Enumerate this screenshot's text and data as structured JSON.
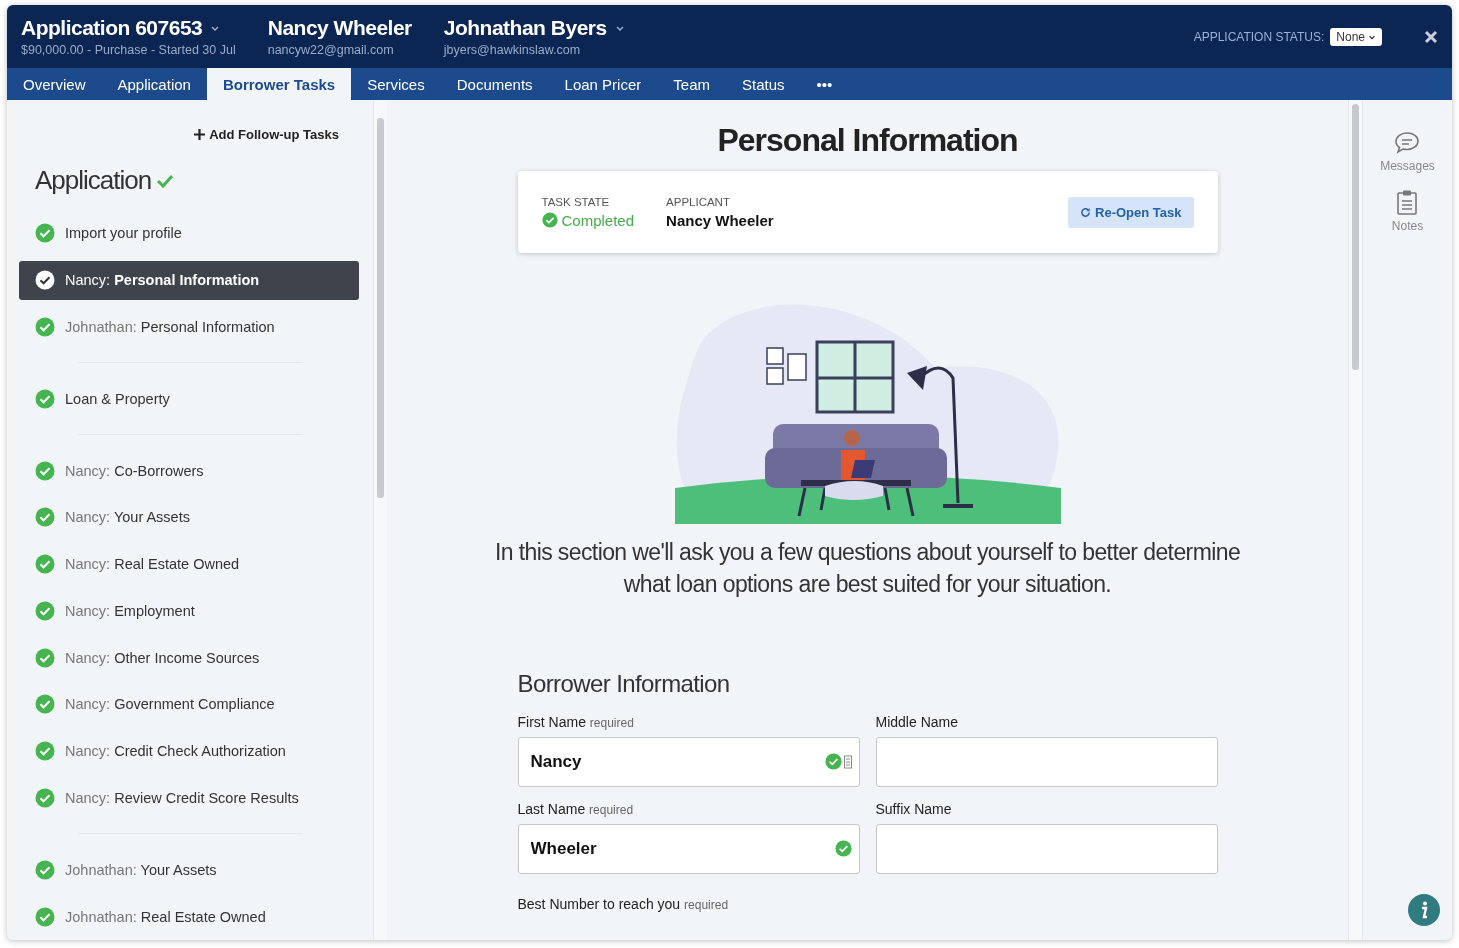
{
  "header": {
    "application": {
      "title": "Application 607653",
      "subtitle": "$90,000.00 - Purchase - Started 30 Jul"
    },
    "borrowers": [
      {
        "name": "Nancy Wheeler",
        "email": "nancyw22@gmail.com",
        "has_menu": false
      },
      {
        "name": "Johnathan Byers",
        "email": "jbyers@hawkinslaw.com",
        "has_menu": true
      }
    ],
    "status_label": "APPLICATION STATUS:",
    "status_value": "None"
  },
  "tabs": [
    {
      "label": "Overview",
      "selected": false
    },
    {
      "label": "Application",
      "selected": false
    },
    {
      "label": "Borrower Tasks",
      "selected": true
    },
    {
      "label": "Services",
      "selected": false
    },
    {
      "label": "Documents",
      "selected": false
    },
    {
      "label": "Loan Pricer",
      "selected": false
    },
    {
      "label": "Team",
      "selected": false
    },
    {
      "label": "Status",
      "selected": false
    }
  ],
  "more_tabs": "•••",
  "sidebar": {
    "add_button": "Add Follow-up Tasks",
    "section_title": "Application",
    "section_complete": true,
    "groups": [
      [
        {
          "title": "Import your profile",
          "completed": true,
          "selected": false
        },
        {
          "prefix": "Nancy:",
          "title": "Personal Information",
          "completed": true,
          "selected": true
        },
        {
          "prefix": "Johnathan:",
          "title": "Personal Information",
          "completed": true,
          "selected": false
        }
      ],
      [
        {
          "title": "Loan & Property",
          "completed": true,
          "selected": false
        }
      ],
      [
        {
          "prefix": "Nancy:",
          "title": "Co-Borrowers",
          "completed": true,
          "selected": false
        },
        {
          "prefix": "Nancy:",
          "title": "Your Assets",
          "completed": true,
          "selected": false
        },
        {
          "prefix": "Nancy:",
          "title": "Real Estate Owned",
          "completed": true,
          "selected": false
        },
        {
          "prefix": "Nancy:",
          "title": "Employment",
          "completed": true,
          "selected": false
        },
        {
          "prefix": "Nancy:",
          "title": "Other Income Sources",
          "completed": true,
          "selected": false
        },
        {
          "prefix": "Nancy:",
          "title": "Government Compliance",
          "completed": true,
          "selected": false
        },
        {
          "prefix": "Nancy:",
          "title": "Credit Check Authorization",
          "completed": true,
          "selected": false
        },
        {
          "prefix": "Nancy:",
          "title": "Review Credit Score Results",
          "completed": true,
          "selected": false
        }
      ],
      [
        {
          "prefix": "Johnathan:",
          "title": "Your Assets",
          "completed": true,
          "selected": false
        },
        {
          "prefix": "Johnathan:",
          "title": "Real Estate Owned",
          "completed": true,
          "selected": false
        }
      ]
    ]
  },
  "main": {
    "title": "Personal Information",
    "task": {
      "state_label": "TASK STATE",
      "state": "Completed",
      "completed": true,
      "applicant_label": "APPLICANT",
      "applicant": "Nancy Wheeler",
      "button": "Re-Open Task"
    },
    "intro": "In this section we'll ask you a few questions about yourself to better determine what loan options are best suited for your situation.",
    "section_title": "Borrower Information",
    "fields": [
      {
        "label": "First Name",
        "hint": "required",
        "value": "Nancy",
        "valid": true,
        "contact_icon": true
      },
      {
        "label": "Middle Name",
        "valid": false,
        "contact_icon": false
      },
      {
        "label": "Last Name",
        "hint": "required",
        "value": "Wheeler",
        "valid": true,
        "contact_icon": false
      },
      {
        "label": "Suffix Name",
        "valid": false,
        "contact_icon": false
      }
    ],
    "next_field": {
      "label": "Best Number to reach you",
      "hint": "required"
    }
  },
  "rail": [
    {
      "kind": "messages",
      "label": "Messages"
    },
    {
      "kind": "notes",
      "label": "Notes"
    }
  ]
}
